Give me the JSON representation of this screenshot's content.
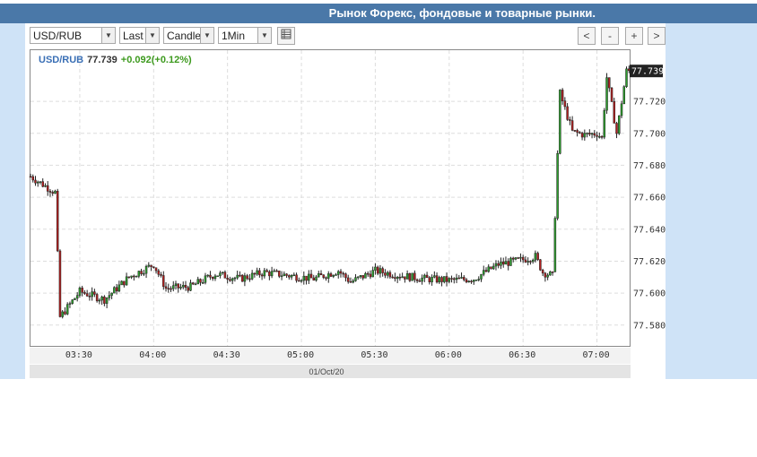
{
  "header": {
    "title": "Рынок Форекс, фондовые и товарные рынки."
  },
  "toolbar": {
    "symbol": "USD/RUB",
    "price_type": "Last",
    "chart_style": "Candle",
    "interval": "1Min",
    "nav": {
      "back": "<",
      "zoom_out": "-",
      "zoom_in": "+",
      "forward": ">"
    }
  },
  "quote": {
    "symbol": "USD/RUB",
    "price": "77.739",
    "change": "+0.092(+0.12%)"
  },
  "colors": {
    "header_bg": "#4a78a8",
    "panel_bg": "#cfe3f7",
    "up": "#2e9e2e",
    "down": "#b02020",
    "symbol_text": "#3a6fb5",
    "change_text": "#3d9a1e"
  },
  "chart_data": {
    "type": "candlestick",
    "symbol": "USD/RUB",
    "interval": "1Min",
    "date": "01/Oct/20",
    "xlabel": "",
    "ylabel": "",
    "x_ticks": [
      "03:30",
      "04:00",
      "04:30",
      "05:00",
      "05:30",
      "06:00",
      "06:30",
      "07:00"
    ],
    "y_ticks": [
      "77.580",
      "77.600",
      "77.620",
      "77.640",
      "77.660",
      "77.680",
      "77.700",
      "77.720"
    ],
    "ylim": [
      77.567,
      77.752
    ],
    "xlim": [
      "03:10",
      "07:14"
    ],
    "last_price": 77.739,
    "grid": true,
    "series": [
      {
        "time": "03:10",
        "value": 77.673
      },
      {
        "time": "03:20",
        "value": 77.663
      },
      {
        "time": "03:22",
        "value": 77.585
      },
      {
        "time": "03:30",
        "value": 77.601
      },
      {
        "time": "03:40",
        "value": 77.596
      },
      {
        "time": "03:50",
        "value": 77.61
      },
      {
        "time": "04:00",
        "value": 77.618
      },
      {
        "time": "04:05",
        "value": 77.603
      },
      {
        "time": "04:15",
        "value": 77.604
      },
      {
        "time": "04:25",
        "value": 77.612
      },
      {
        "time": "04:35",
        "value": 77.609
      },
      {
        "time": "04:45",
        "value": 77.613
      },
      {
        "time": "04:55",
        "value": 77.611
      },
      {
        "time": "05:05",
        "value": 77.609
      },
      {
        "time": "05:15",
        "value": 77.614
      },
      {
        "time": "05:20",
        "value": 77.607
      },
      {
        "time": "05:30",
        "value": 77.614
      },
      {
        "time": "05:40",
        "value": 77.611
      },
      {
        "time": "05:50",
        "value": 77.609
      },
      {
        "time": "06:00",
        "value": 77.608
      },
      {
        "time": "06:10",
        "value": 77.609
      },
      {
        "time": "06:20",
        "value": 77.618
      },
      {
        "time": "06:30",
        "value": 77.621
      },
      {
        "time": "06:35",
        "value": 77.623
      },
      {
        "time": "06:38",
        "value": 77.613
      },
      {
        "time": "06:42",
        "value": 77.611
      },
      {
        "time": "06:45",
        "value": 77.725
      },
      {
        "time": "06:50",
        "value": 77.701
      },
      {
        "time": "06:55",
        "value": 77.699
      },
      {
        "time": "07:00",
        "value": 77.7
      },
      {
        "time": "07:02",
        "value": 77.697
      },
      {
        "time": "07:04",
        "value": 77.735
      },
      {
        "time": "07:08",
        "value": 77.7
      },
      {
        "time": "07:12",
        "value": 77.739
      }
    ]
  }
}
